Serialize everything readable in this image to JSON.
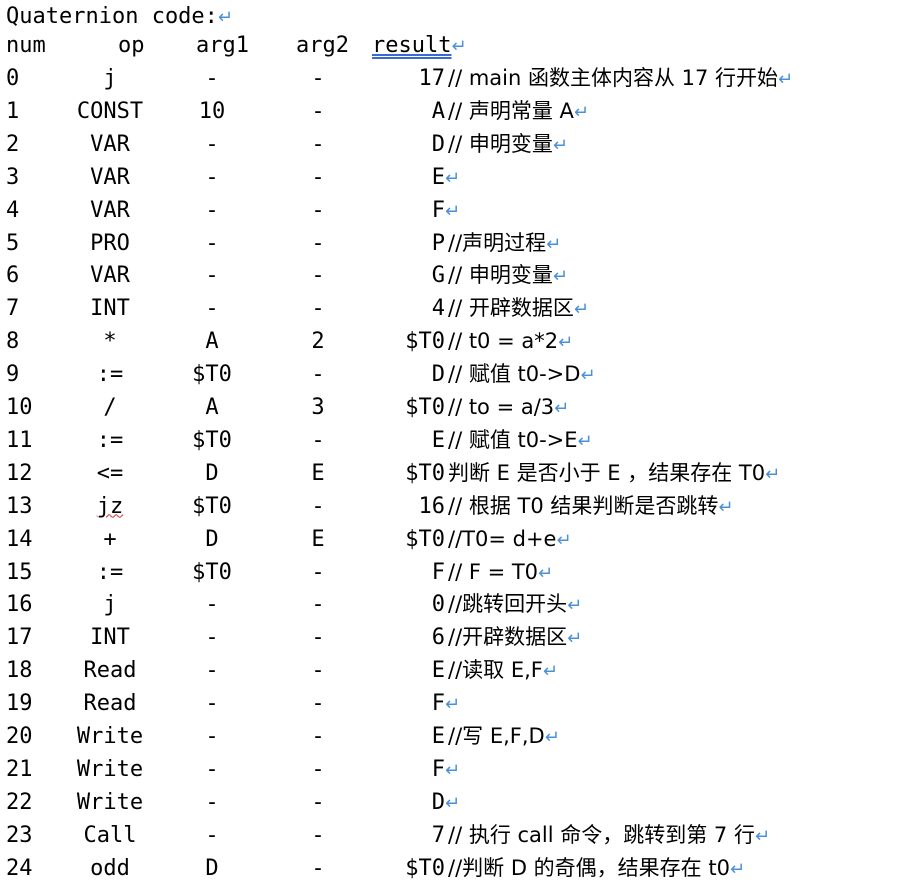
{
  "title": "Quaternion code:",
  "return_mark": "↵",
  "columns": {
    "num": "num",
    "op": "op",
    "arg1": "arg1",
    "arg2": "arg2",
    "result": "result"
  },
  "rows": [
    {
      "num": "0",
      "op": "j",
      "arg1": "-",
      "arg2": "-",
      "result": "17",
      "comment": "// main 函数主体内容从 17 行开始"
    },
    {
      "num": "1",
      "op": "CONST",
      "arg1": "10",
      "arg2": "-",
      "result": "A",
      "comment": "// 声明常量 A"
    },
    {
      "num": "2",
      "op": "VAR",
      "arg1": "-",
      "arg2": "-",
      "result": "D",
      "comment": "// 申明变量"
    },
    {
      "num": "3",
      "op": "VAR",
      "arg1": "-",
      "arg2": "-",
      "result": "E",
      "comment": ""
    },
    {
      "num": "4",
      "op": "VAR",
      "arg1": "-",
      "arg2": "-",
      "result": "F",
      "comment": ""
    },
    {
      "num": "5",
      "op": "PRO",
      "arg1": "-",
      "arg2": "-",
      "result": "P",
      "comment": "//声明过程"
    },
    {
      "num": "6",
      "op": "VAR",
      "arg1": "-",
      "arg2": "-",
      "result": "G",
      "comment": "// 申明变量"
    },
    {
      "num": "7",
      "op": "INT",
      "arg1": "-",
      "arg2": "-",
      "result": "4",
      "comment": "// 开辟数据区"
    },
    {
      "num": "8",
      "op": "*",
      "arg1": "A",
      "arg2": "2",
      "result": "$T0",
      "comment": "// t0 = a*2"
    },
    {
      "num": "9",
      "op": ":=",
      "arg1": "$T0",
      "arg2": "-",
      "result": "D",
      "comment": "// 赋值 t0->D"
    },
    {
      "num": "10",
      "op": "/",
      "arg1": "A",
      "arg2": "3",
      "result": "$T0",
      "comment": "// to = a/3"
    },
    {
      "num": "11",
      "op": ":=",
      "arg1": "$T0",
      "arg2": "-",
      "result": "E",
      "comment": "// 赋值 t0->E"
    },
    {
      "num": "12",
      "op": "<=",
      "arg1": "D",
      "arg2": "E",
      "result": "$T0",
      "comment": "判断 E 是否小于 E ，结果存在 T0"
    },
    {
      "num": "13",
      "op": "jz",
      "arg1": "$T0",
      "arg2": "-",
      "result": "16",
      "comment": "// 根据 T0 结果判断是否跳转"
    },
    {
      "num": "14",
      "op": "+",
      "arg1": "D",
      "arg2": "E",
      "result": "$T0",
      "comment": "//T0= d+e"
    },
    {
      "num": "15",
      "op": ":=",
      "arg1": "$T0",
      "arg2": "-",
      "result": "F",
      "comment": "// F = T0"
    },
    {
      "num": "16",
      "op": "j",
      "arg1": "-",
      "arg2": "-",
      "result": "0",
      "comment": "//跳转回开头"
    },
    {
      "num": "17",
      "op": "INT",
      "arg1": "-",
      "arg2": "-",
      "result": "6",
      "comment": "//开辟数据区"
    },
    {
      "num": "18",
      "op": "Read",
      "arg1": "-",
      "arg2": "-",
      "result": "E",
      "comment": "//读取 E,F"
    },
    {
      "num": "19",
      "op": "Read",
      "arg1": "-",
      "arg2": "-",
      "result": "F",
      "comment": ""
    },
    {
      "num": "20",
      "op": "Write",
      "arg1": "-",
      "arg2": "-",
      "result": "E",
      "comment": "//写 E,F,D"
    },
    {
      "num": "21",
      "op": "Write",
      "arg1": "-",
      "arg2": "-",
      "result": "F",
      "comment": ""
    },
    {
      "num": "22",
      "op": "Write",
      "arg1": "-",
      "arg2": "-",
      "result": "D",
      "comment": ""
    },
    {
      "num": "23",
      "op": "Call",
      "arg1": "-",
      "arg2": "-",
      "result": "7",
      "comment": "// 执行 call 命令，跳转到第 7 行"
    },
    {
      "num": "24",
      "op": "odd",
      "arg1": "D",
      "arg2": "-",
      "result": "$T0",
      "comment": "//判断 D 的奇偶，结果存在 t0"
    }
  ]
}
